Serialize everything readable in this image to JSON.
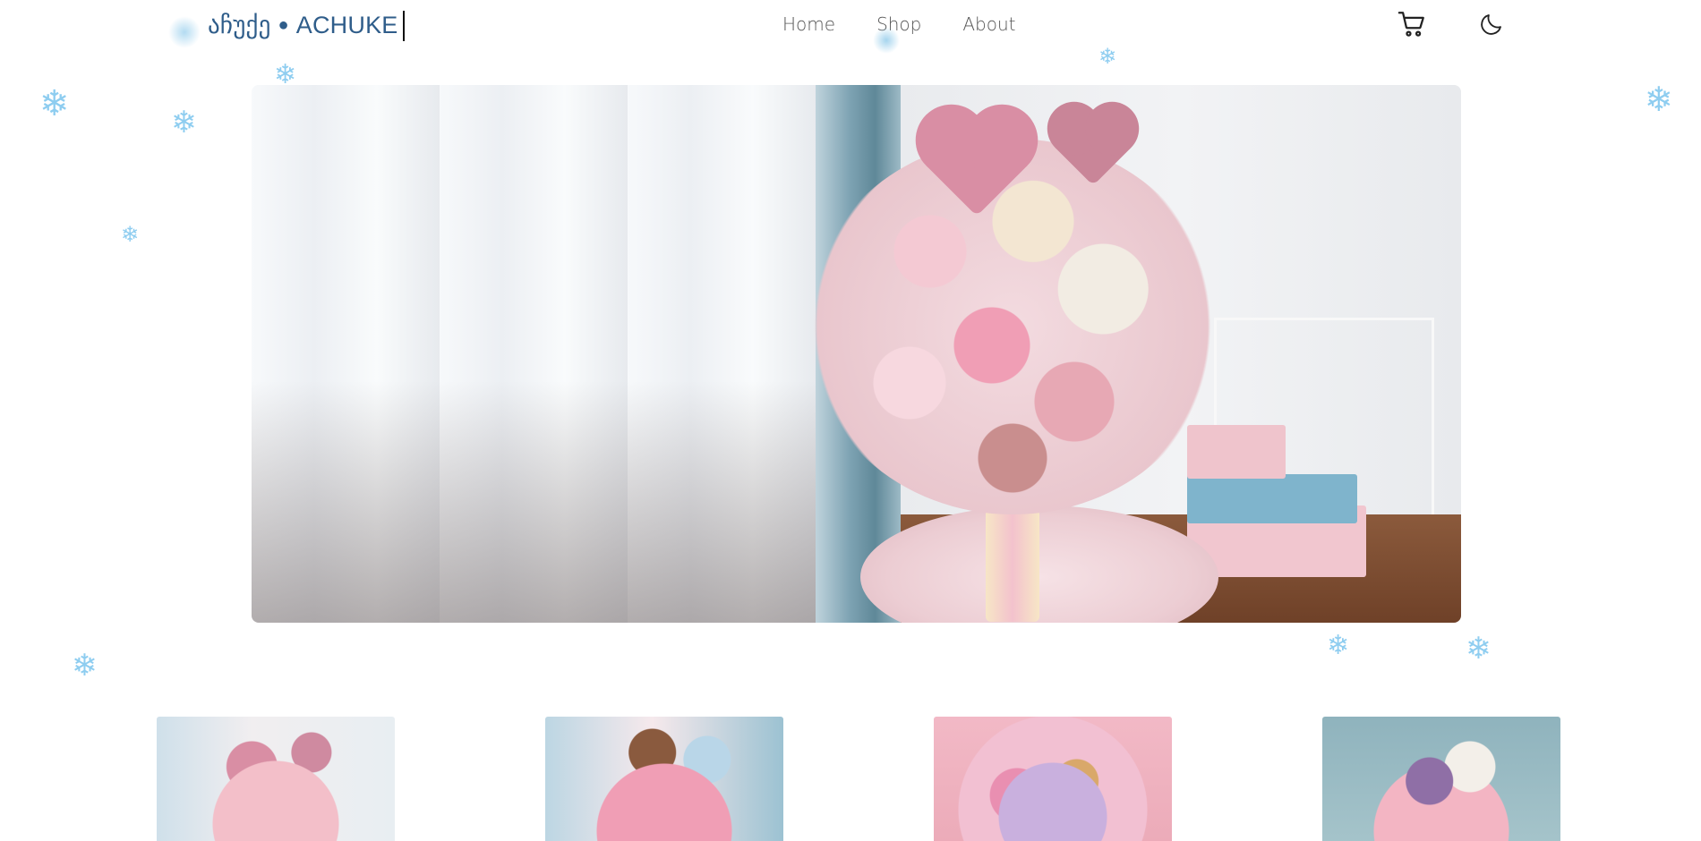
{
  "header": {
    "brand_georgian": "აჩუქე",
    "brand_dot": "●",
    "brand_latin": "ACHUKE",
    "nav": [
      {
        "label": "Home"
      },
      {
        "label": "Shop"
      },
      {
        "label": "About"
      }
    ],
    "icons": {
      "cart": "shopping-cart-icon",
      "theme": "moon-icon"
    }
  },
  "hero": {
    "image": "balloon-flower-bouquet-hero"
  },
  "products": [
    {
      "image": "product-bouquet-1"
    },
    {
      "image": "product-bouquet-2"
    },
    {
      "image": "product-bouquet-3"
    },
    {
      "image": "product-bouquet-4"
    }
  ],
  "decor": {
    "snowflake_glyph": "❄",
    "snow_color": "#8ecdf0",
    "brand_color": "#2f5d8a"
  }
}
